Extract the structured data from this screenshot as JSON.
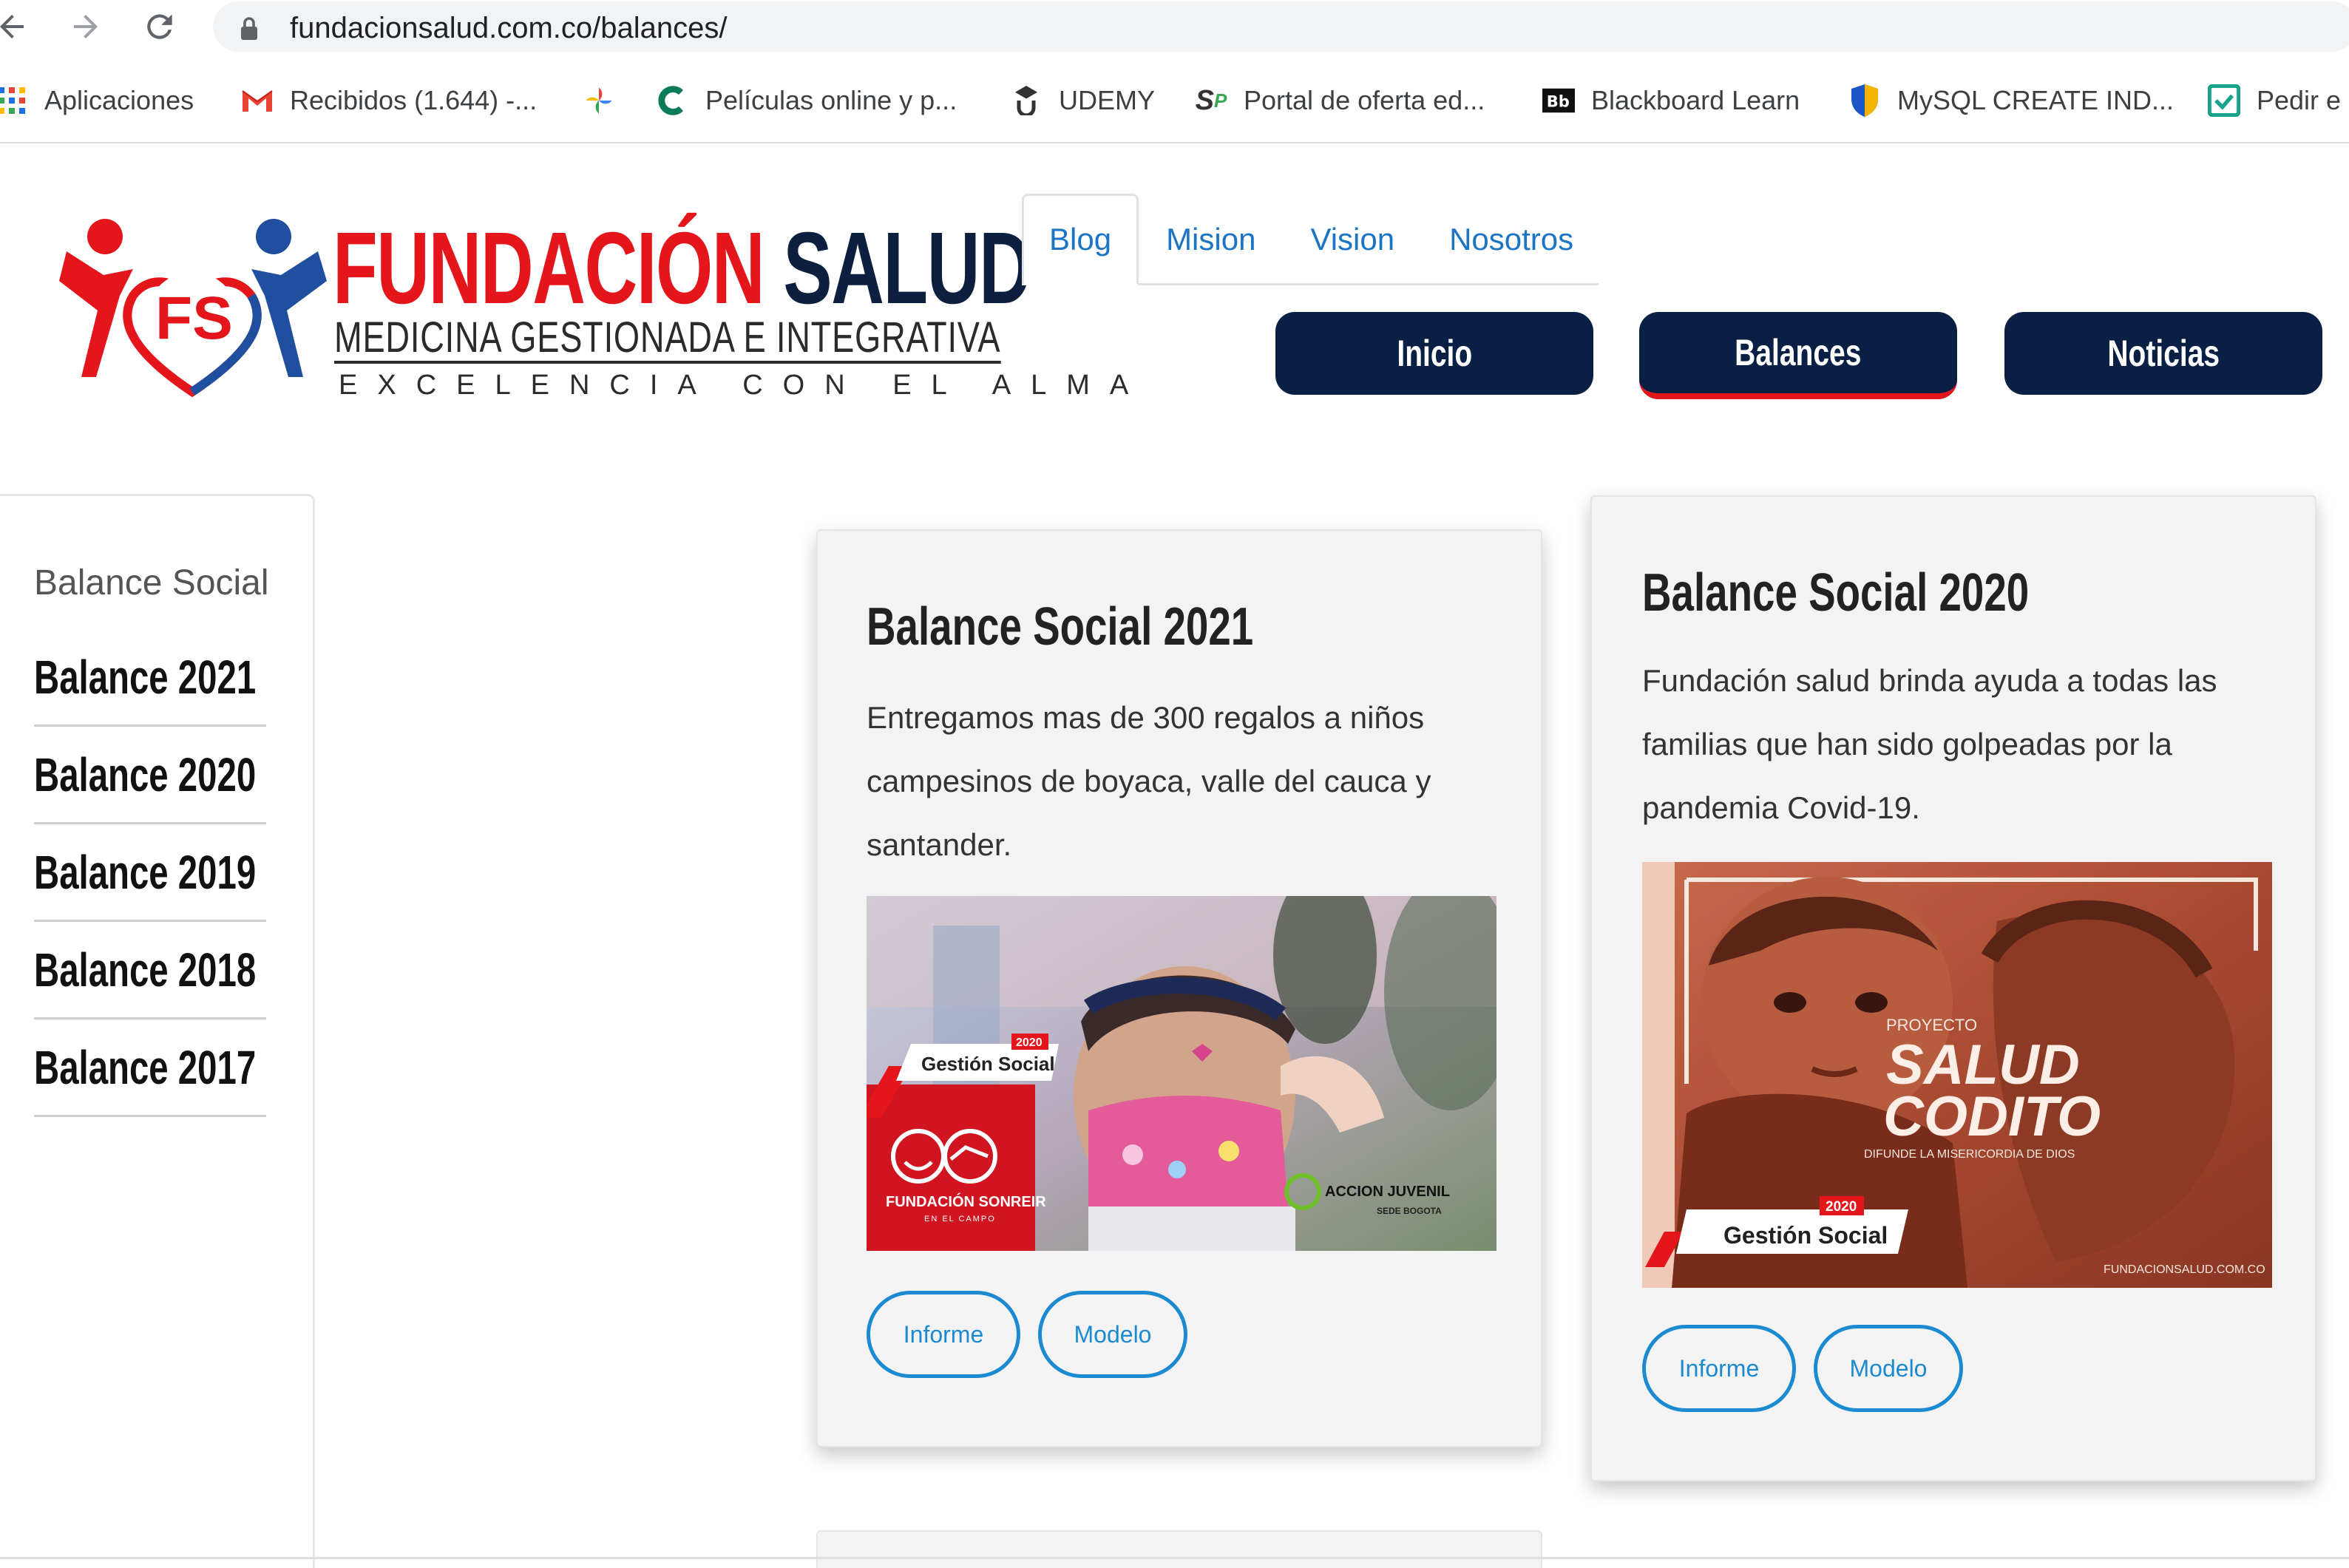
{
  "browser": {
    "url": "fundacionsalud.com.co/balances/",
    "bookmarks": [
      {
        "label": "Aplicaciones",
        "icon": "apps-grid-icon"
      },
      {
        "label": "Recibidos (1.644) -...",
        "icon": "gmail-icon"
      },
      {
        "label": "",
        "icon": "pinwheel-icon"
      },
      {
        "label": "Películas online y p...",
        "icon": "c-logo-icon"
      },
      {
        "label": "UDEMY",
        "icon": "udemy-icon"
      },
      {
        "label": "Portal de oferta ed...",
        "icon": "sp-logo-icon"
      },
      {
        "label": "Blackboard Learn",
        "icon": "blackboard-icon"
      },
      {
        "label": "MySQL CREATE IND...",
        "icon": "shield-icon"
      },
      {
        "label": "Pedir e",
        "icon": "check-heart-icon"
      }
    ]
  },
  "site": {
    "logo": {
      "monogram": "FS",
      "title_red": "FUNDACIÓN",
      "title_navy": "SALUD",
      "subtitle": "MEDICINA GESTIONADA E INTEGRATIVA",
      "tagline": "EXCELENCIA CON EL ALMA"
    },
    "tabs": [
      {
        "label": "Blog",
        "active": true
      },
      {
        "label": "Mision",
        "active": false
      },
      {
        "label": "Vision",
        "active": false
      },
      {
        "label": "Nosotros",
        "active": false
      }
    ],
    "nav_buttons": [
      {
        "label": "Inicio",
        "active": false
      },
      {
        "label": "Balances",
        "active": true
      },
      {
        "label": "Noticias",
        "active": false
      }
    ]
  },
  "sidebar": {
    "heading": "Balance Social",
    "items": [
      "Balance 2021",
      "Balance 2020",
      "Balance 2019",
      "Balance 2018",
      "Balance 2017"
    ]
  },
  "cards": [
    {
      "title": "Balance Social 2021",
      "text": "Entregamos mas de 300 regalos a niños campesinos de boyaca, valle del cauca y santander.",
      "image": {
        "badge_year": "2020",
        "badge_label": "Gestión Social",
        "brand": "FUNDACIÓN SONREIR",
        "brand_sub": "EN EL CAMPO",
        "partner": "ACCION JUVENIL",
        "partner_sub": "SEDE BOGOTA"
      },
      "buttons": [
        "Informe",
        "Modelo"
      ]
    },
    {
      "title": "Balance Social 2020",
      "text": "Fundación salud brinda ayuda a todas las familias que han sido golpeadas por la pandemia Covid-19.",
      "image": {
        "kicker": "PROYECTO",
        "headline_1": "SALUD",
        "headline_2": "CODITO",
        "caption": "DIFUNDE LA MISERICORDIA DE DIOS",
        "badge_year": "2020",
        "badge_label": "Gestión Social",
        "footer": "FUNDACIONSALUD.COM.CO"
      },
      "buttons": [
        "Informe",
        "Modelo"
      ]
    }
  ],
  "colors": {
    "navy": "#0a1f44",
    "brand_red": "#e4161b",
    "link_blue": "#1b74c4",
    "button_blue": "#1b8ad1"
  }
}
